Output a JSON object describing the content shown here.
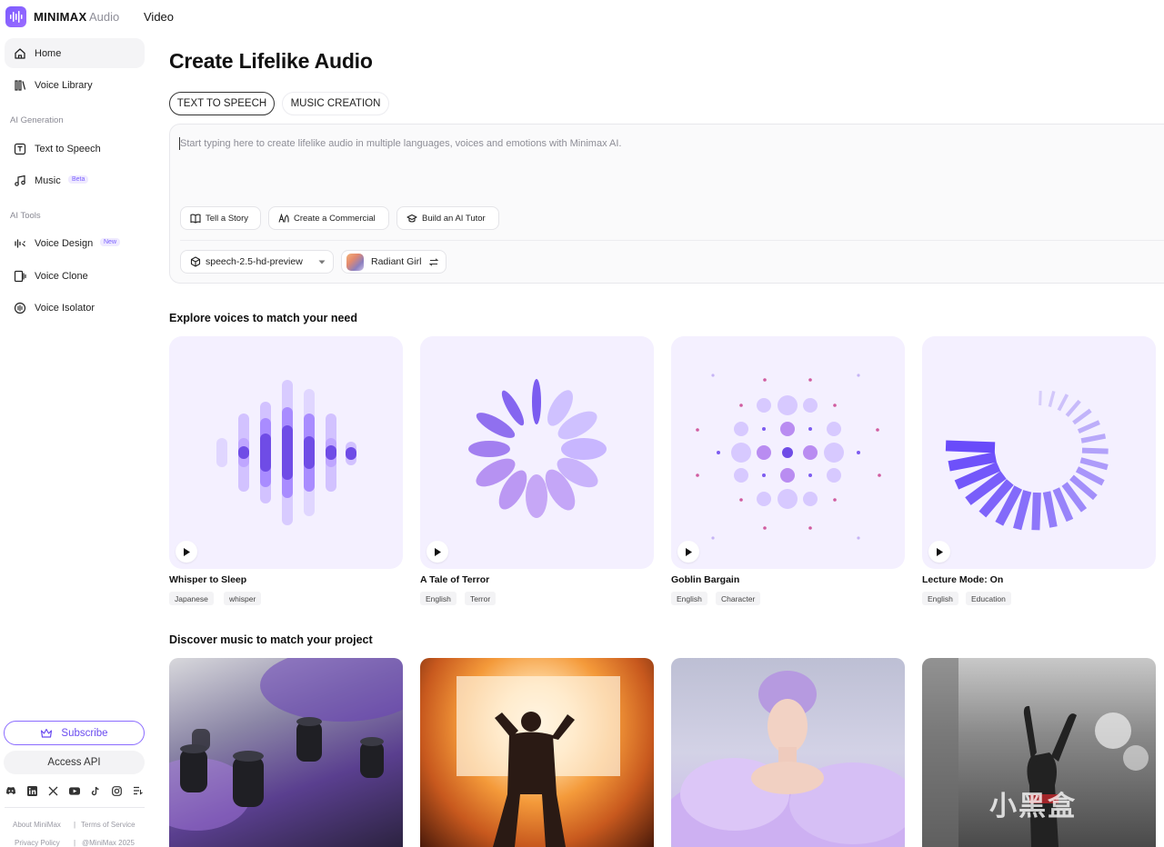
{
  "topbar": {
    "brand": "MINIMAX",
    "product": "Audio",
    "video_link": "Video"
  },
  "sidebar": {
    "home": "Home",
    "voice_library": "Voice Library",
    "section_generation": "AI Generation",
    "text_to_speech": "Text to Speech",
    "music": "Music",
    "music_badge": "Beta",
    "section_tools": "AI Tools",
    "voice_design": "Voice Design",
    "voice_design_badge": "New",
    "voice_clone": "Voice Clone",
    "voice_isolator": "Voice Isolator",
    "subscribe": "Subscribe",
    "access_api": "Access API",
    "footer": {
      "about": "About MiniMax",
      "terms": "Terms of Service",
      "privacy": "Privacy Policy",
      "copyright": "@MiniMax 2025"
    }
  },
  "main": {
    "title": "Create Lifelike Audio",
    "tabs": [
      "TEXT TO SPEECH",
      "MUSIC CREATION"
    ],
    "editor_placeholder": "Start typing here to create lifelike audio in multiple languages, voices and emotions with Minimax AI.",
    "prompt_chips": [
      "Tell a Story",
      "Create a Commercial",
      "Build an AI Tutor"
    ],
    "model_select": "speech-2.5-hd-preview",
    "voice_select": "Radiant Girl",
    "explore_title": "Explore voices to match your need",
    "voices": [
      {
        "title": "Whisper to Sleep",
        "tags": [
          "Japanese",
          "whisper"
        ]
      },
      {
        "title": "A Tale of Terror",
        "tags": [
          "English",
          "Terror"
        ]
      },
      {
        "title": "Goblin Bargain",
        "tags": [
          "English",
          "Character"
        ]
      },
      {
        "title": "Lecture Mode: On",
        "tags": [
          "English",
          "Education"
        ]
      }
    ],
    "music_title": "Discover music to match your project"
  },
  "watermark": "小黑盒",
  "colors": {
    "accent": "#7b5cff",
    "card_bg": "#f4f0ff"
  }
}
